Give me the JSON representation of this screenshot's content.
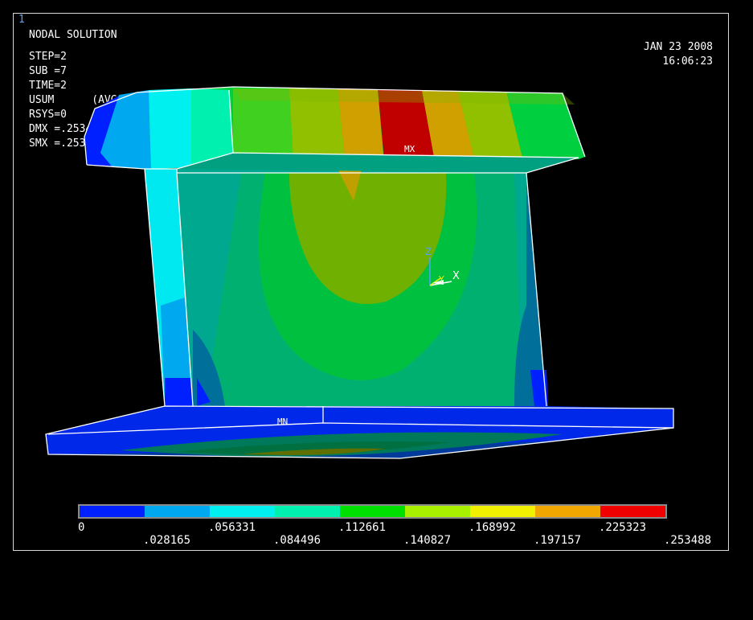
{
  "window_number": "1",
  "header": {
    "title": "NODAL SOLUTION",
    "info_lines": [
      "STEP=2",
      "SUB =7",
      "TIME=2",
      "USUM      (AVG)",
      "RSYS=0",
      "DMX =.253488",
      "SMX =.253488"
    ],
    "date": "JAN 23 2008",
    "time": "16:06:23"
  },
  "model_labels": {
    "max": "MX",
    "min": "MN"
  },
  "triad": {
    "z": "Z",
    "y": "Y",
    "x": "X"
  },
  "legend": {
    "colors": [
      "#0020ff",
      "#00a8f0",
      "#00f0f0",
      "#00f0b0",
      "#00e000",
      "#a8f000",
      "#f0f000",
      "#f0a800",
      "#f00000"
    ],
    "ticks_top": [
      "0",
      ".056331",
      ".112661",
      ".168992",
      ".225323"
    ],
    "ticks_bottom": [
      ".028165",
      ".084496",
      ".140827",
      ".197157",
      ".253488"
    ]
  }
}
